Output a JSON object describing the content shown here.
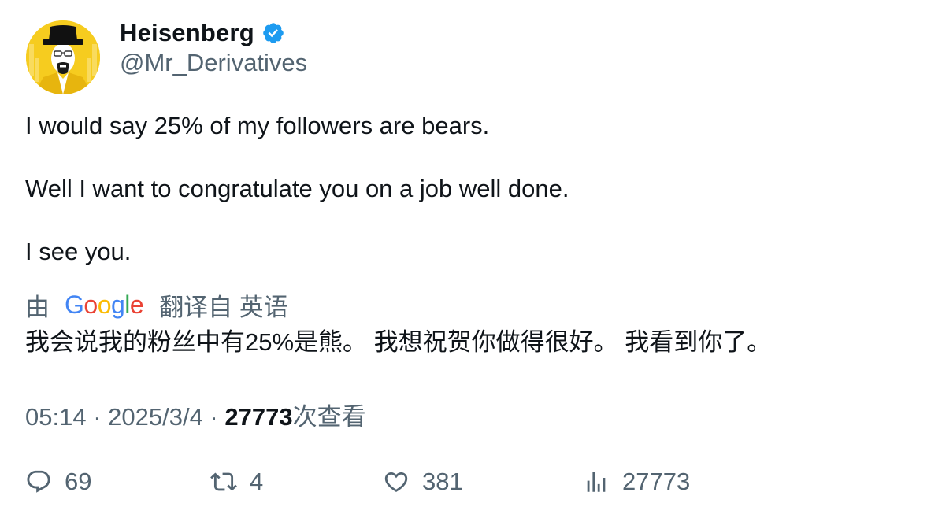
{
  "author": {
    "display_name": "Heisenberg",
    "handle": "@Mr_Derivatives",
    "verified": true
  },
  "tweet": {
    "paragraphs": [
      "I would say 25% of my followers are bears.",
      "Well I want to congratulate you on a job well done.",
      "I see you."
    ]
  },
  "translation": {
    "prefix": "由",
    "provider_letters": [
      "G",
      "o",
      "o",
      "g",
      "l",
      "e"
    ],
    "suffix": "翻译自 英语",
    "text": "我会说我的粉丝中有25%是熊。 我想祝贺你做得很好。 我看到你了。"
  },
  "meta": {
    "time": "05:14",
    "separator": " · ",
    "date": "2025/3/4",
    "views_count": "27773",
    "views_label": "次查看"
  },
  "actions": {
    "replies": "69",
    "retweets": "4",
    "likes": "381",
    "views": "27773"
  },
  "colors": {
    "text_primary": "#0f1419",
    "text_secondary": "#536471",
    "verified_blue": "#1d9bf0",
    "avatar_yellow": "#f6cc1f"
  },
  "icons": {
    "verified": "verified-badge-icon",
    "reply": "reply-icon",
    "retweet": "retweet-icon",
    "like": "heart-icon",
    "views": "analytics-icon"
  }
}
